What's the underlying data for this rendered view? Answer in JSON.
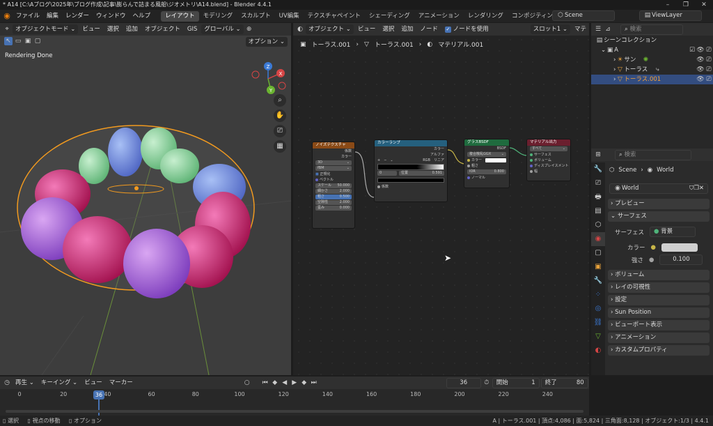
{
  "window": {
    "title": "* A14 [C:\\Aブログ\\2025年\\ブログ作成\\記事\\膨らんで詰まる風船\\ジオメトリ\\A14.blend] - Blender 4.4.1",
    "controls": [
      "–",
      "❐",
      "✕"
    ]
  },
  "menu": {
    "items": [
      "ファイル",
      "編集",
      "レンダー",
      "ウィンドウ",
      "ヘルプ"
    ],
    "workspaces": [
      "レイアウト",
      "モデリング",
      "スカルプト",
      "UV編集",
      "テクスチャペイント",
      "シェーディング",
      "アニメーション",
      "レンダリング",
      "コンポジティング"
    ],
    "active_workspace": "レイアウト",
    "scene": "Scene",
    "view_layer": "ViewLayer"
  },
  "viewport": {
    "mode": "オブジェクトモード",
    "menus": [
      "ビュー",
      "選択",
      "追加",
      "オブジェクト",
      "GIS"
    ],
    "transform": "グローバル",
    "options": "オプション",
    "status": "Rendering Done",
    "gizmo": {
      "x": "X",
      "y": "Y",
      "z": "Z"
    }
  },
  "node_editor": {
    "type": "オブジェクト",
    "menus": [
      "ビュー",
      "選択",
      "追加",
      "ノード"
    ],
    "use_nodes_label": "ノードを使用",
    "slot": "スロット1",
    "material_short": "マテ",
    "breadcrumb": [
      "トーラス.001",
      "トーラス.001",
      "マテリアル.001"
    ],
    "nodes": {
      "noise": {
        "title": "ノイズテクスチャ",
        "outputs": [
          "係数",
          "カラー"
        ],
        "dims": "3D",
        "type": "fBM",
        "normalize": "正規化",
        "vector": "ベクトル",
        "fields": [
          {
            "label": "スケール",
            "value": "50.000"
          },
          {
            "label": "細かさ",
            "value": "2.000"
          },
          {
            "label": "粗さ",
            "value": "0.500"
          },
          {
            "label": "空隙性",
            "value": "2.000"
          },
          {
            "label": "歪み",
            "value": "0.000"
          }
        ]
      },
      "ramp": {
        "title": "カラーランプ",
        "outputs": [
          "カラー",
          "アルファ"
        ],
        "controls": [
          "+",
          "−",
          "⌄"
        ],
        "color_mode": "RGB",
        "interp": "リニア",
        "stop_index": "0",
        "pos_label": "位置",
        "pos_value": "0.591",
        "input": "係数"
      },
      "glass": {
        "title": "グラスBSDF",
        "output": "BSDF",
        "distribution": "複合散乱GGX",
        "rows": [
          "カラー",
          "粗さ"
        ],
        "ior_label": "IOR",
        "ior_value": "0.800",
        "normal": "ノーマル"
      },
      "output": {
        "title": "マテリアル出力",
        "target": "すべて",
        "inputs": [
          "サーフェス",
          "ボリューム",
          "ディスプレイスメント",
          "幅"
        ]
      }
    }
  },
  "outliner": {
    "search_placeholder": "検索",
    "root": "シーンコレクション",
    "collection": "A",
    "items": [
      "サン",
      "トーラス",
      "トーラス.001"
    ]
  },
  "properties": {
    "search_placeholder": "検索",
    "breadcrumb": [
      "Scene",
      "World"
    ],
    "world_name": "World",
    "panels": {
      "preview": "プレビュー",
      "surface": "サーフェス",
      "surface_label": "サーフェス",
      "surface_value": "背景",
      "color_label": "カラー",
      "strength_label": "強さ",
      "strength_value": "0.100",
      "volume": "ボリューム",
      "ray_visibility": "レイの可視性",
      "settings": "設定",
      "sun_position": "Sun Position",
      "viewport_display": "ビューポート表示",
      "animation": "アニメーション",
      "custom_props": "カスタムプロパティ"
    }
  },
  "timeline": {
    "menus": [
      "再生",
      "キーイング",
      "ビュー",
      "マーカー"
    ],
    "current_frame": "36",
    "start_label": "開始",
    "start": "1",
    "end_label": "終了",
    "end": "80",
    "ticks": [
      "0",
      "20",
      "40",
      "60",
      "80",
      "100",
      "120",
      "140",
      "160",
      "180",
      "200",
      "220",
      "240"
    ]
  },
  "statusbar": {
    "left": [
      "選択",
      "視点の移動",
      "オプション"
    ],
    "right": "A | トーラス.001 | 頂点:4,086 | 面:5,824 | 三角面:8,128 | オブジェクト:1/3 | 4.4.1"
  }
}
